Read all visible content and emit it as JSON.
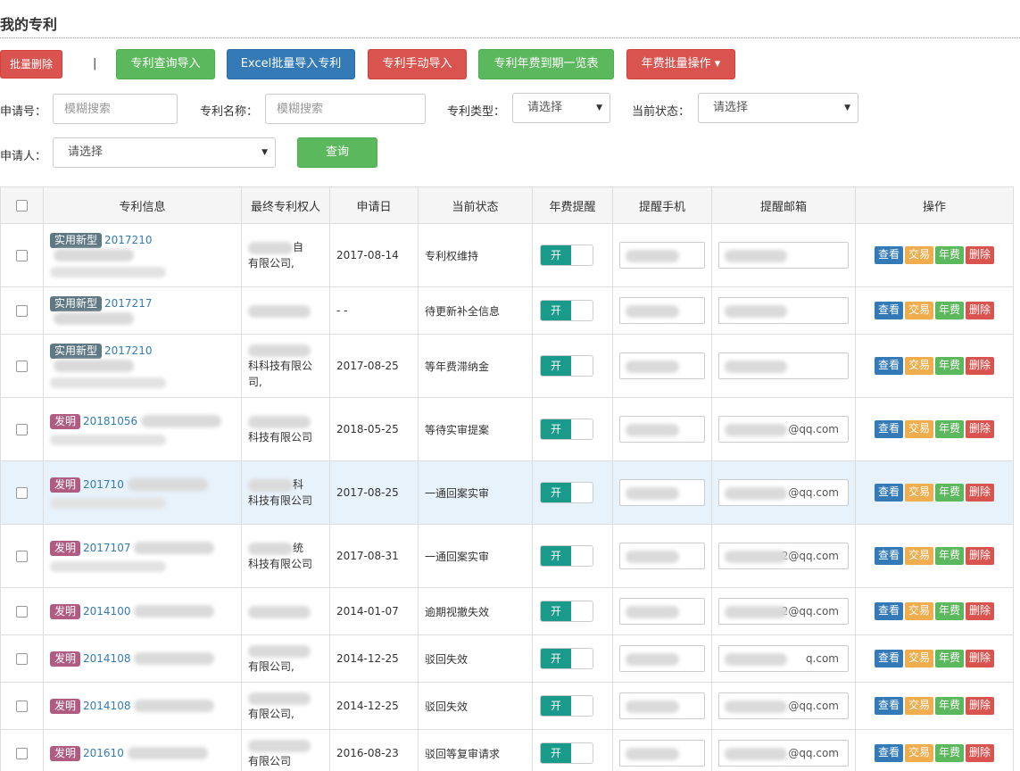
{
  "page": {
    "title": "我的专利"
  },
  "toolbar": {
    "batch_delete": "批量删除",
    "separator": "|",
    "query_import": "专利查询导入",
    "excel_import": "Excel批量导入专利",
    "manual_import": "专利手动导入",
    "fee_due_list": "专利年费到期一览表",
    "fee_batch": "年费批量操作 ▾"
  },
  "filters": {
    "app_no_label": "申请号：",
    "app_no_placeholder": "模糊搜索",
    "name_label": "专利名称：",
    "name_placeholder": "模糊搜索",
    "type_label": "专利类型：",
    "type_value": "请选择",
    "status_label": "当前状态：",
    "status_value": "请选择",
    "applicant_label": "申请人：",
    "applicant_value": "请选择",
    "query_button": "查询"
  },
  "table": {
    "headers": [
      "专利信息",
      "最终专利权人",
      "申请日",
      "当前状态",
      "年费提醒",
      "提醒手机",
      "提醒邮箱",
      "操作"
    ],
    "toggle_on": "开",
    "actions": {
      "view": "查看",
      "trade": "交易",
      "fee": "年费",
      "delete": "删除"
    },
    "rows": [
      {
        "type": "实用新型",
        "kind": "um",
        "no": "2017210",
        "owner": "有限公司,",
        "owner_top": "自",
        "date": "2017-08-14",
        "status": "专利权维持",
        "email": ""
      },
      {
        "type": "实用新型",
        "kind": "um",
        "no": "2017217",
        "owner": "",
        "owner_top": "",
        "date": "- -",
        "status": "待更新补全信息",
        "email": ""
      },
      {
        "type": "实用新型",
        "kind": "um",
        "no": "2017210",
        "owner": "科科技有限公司,",
        "owner_top": "",
        "date": "2017-08-25",
        "status": "等年费滞纳金",
        "email": ""
      },
      {
        "type": "发明",
        "kind": "inv",
        "no": "20181056",
        "owner": "科技有限公司",
        "owner_top": "",
        "date": "2018-05-25",
        "status": "等待实审提案",
        "email": "@qq.com"
      },
      {
        "type": "发明",
        "kind": "inv",
        "no": "201710",
        "owner": "科技有限公司",
        "owner_top": "科",
        "date": "2017-08-25",
        "status": "一通回案实审",
        "email": "@qq.com"
      },
      {
        "type": "发明",
        "kind": "inv",
        "no": "2017107",
        "owner": "科技有限公司",
        "owner_top": "统",
        "date": "2017-08-31",
        "status": "一通回案实审",
        "email": "2@qq.com"
      },
      {
        "type": "发明",
        "kind": "inv",
        "no": "2014100",
        "owner": "",
        "owner_top": "",
        "date": "2014-01-07",
        "status": "逾期视撤失效",
        "email": "2@qq.com"
      },
      {
        "type": "发明",
        "kind": "inv",
        "no": "2014108",
        "owner": "有限公司,",
        "owner_top": "",
        "date": "2014-12-25",
        "status": "驳回失效",
        "email": "q.com"
      },
      {
        "type": "发明",
        "kind": "inv",
        "no": "2014108",
        "owner": "有限公司,",
        "owner_top": "",
        "date": "2014-12-25",
        "status": "驳回失效",
        "email": "@qq.com"
      },
      {
        "type": "发明",
        "kind": "inv",
        "no": "201610",
        "owner": "有限公司",
        "owner_top": "",
        "date": "2016-08-23",
        "status": "驳回等复审请求",
        "email": "@qq.com"
      }
    ]
  }
}
